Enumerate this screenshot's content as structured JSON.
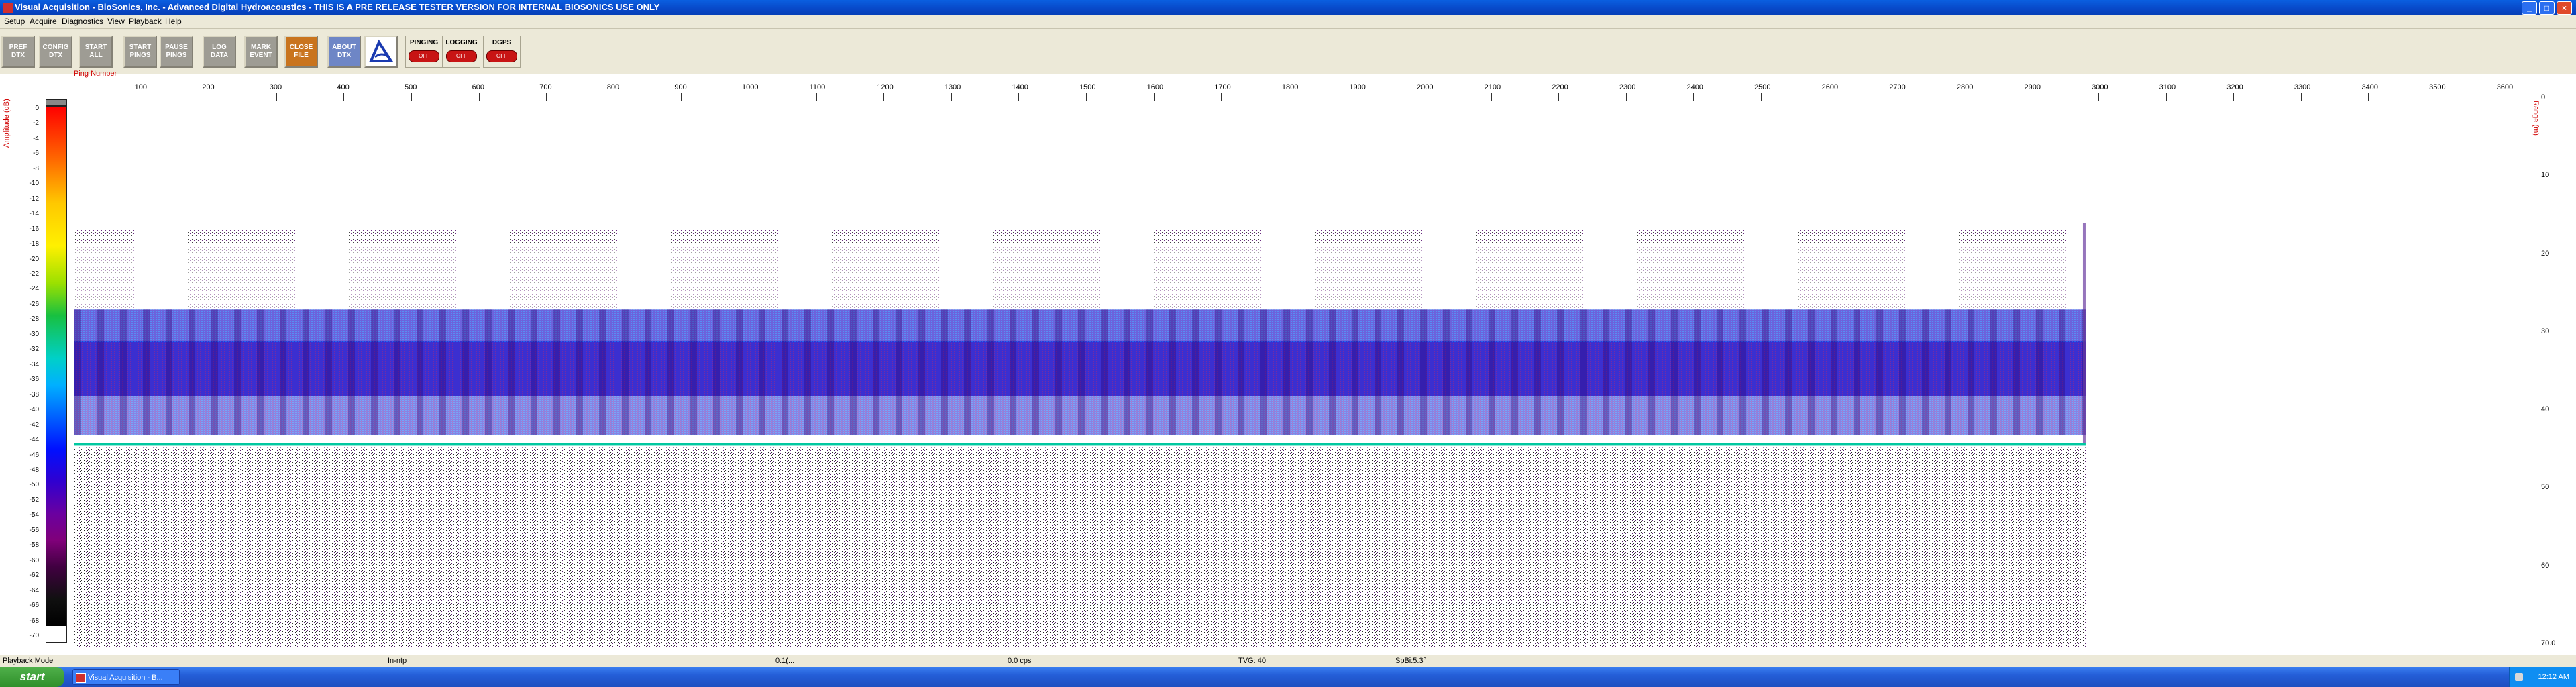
{
  "window": {
    "title": "Visual Acquisition  -  BioSonics, Inc.  -  Advanced Digital Hydroacoustics  -  THIS IS A PRE RELEASE TESTER VERSION FOR INTERNAL BIOSONICS USE ONLY",
    "minimize": "_",
    "maximize": "□",
    "close": "×"
  },
  "menu": [
    "Setup",
    "Acquire",
    "Diagnostics",
    "View",
    "Playback",
    "Help"
  ],
  "toolbar": {
    "buttons": [
      {
        "label": "PREF\nDTX",
        "style": "gray"
      },
      {
        "label": "CONFIG\nDTX",
        "style": "gray"
      },
      {
        "label": "START\nALL",
        "style": "gray"
      },
      {
        "label": "START\nPINGS",
        "style": "gray"
      },
      {
        "label": "PAUSE\nPINGS",
        "style": "gray"
      },
      {
        "label": "LOG\nDATA",
        "style": "gray"
      },
      {
        "label": "MARK\nEVENT",
        "style": "gray"
      },
      {
        "label": "CLOSE\nFILE",
        "style": "orange"
      },
      {
        "label": "ABOUT\nDTX",
        "style": "blue"
      }
    ],
    "indicators": [
      {
        "label": "PINGING",
        "state": "OFF"
      },
      {
        "label": "LOGGING",
        "state": "OFF"
      },
      {
        "label": "DGPS",
        "state": "OFF"
      }
    ]
  },
  "colors": {
    "accent": "#0848c8",
    "echo_main": "#2a2ad8",
    "bottom_line": "#00c8a0",
    "indicator_off": "#c81414"
  },
  "echogram": {
    "colorbar_label": "Amplitude (dB)",
    "colorbar_ticks": [
      0,
      -2,
      -4,
      -6,
      -8,
      -10,
      -12,
      -14,
      -16,
      -18,
      -20,
      -22,
      -24,
      -26,
      -28,
      -30,
      -32,
      -34,
      -36,
      -38,
      -40,
      -42,
      -44,
      -46,
      -48,
      -50,
      -52,
      -54,
      -56,
      -58,
      -60,
      -62,
      -64,
      -66,
      -68,
      -70
    ],
    "x_axis_label": "Ping Number",
    "x_ticks": [
      100,
      200,
      300,
      400,
      500,
      600,
      700,
      800,
      900,
      1000,
      1100,
      1200,
      1300,
      1400,
      1500,
      1600,
      1700,
      1800,
      1900,
      2000,
      2100,
      2200,
      2300,
      2400,
      2500,
      2600,
      2700,
      2800,
      2900,
      3000,
      3100,
      3200,
      3300,
      3400,
      3500,
      3600
    ],
    "range_label": "Range (m)",
    "range_ticks": [
      "0",
      "10",
      "20",
      "30",
      "40",
      "50",
      "60",
      "70.0"
    ],
    "last_ping": 2980,
    "max_range": 70
  },
  "status": {
    "mode": "Playback Mode",
    "field2": "In-ntp",
    "field3": "0.1(...",
    "field4": "0.0 cps",
    "field5": "TVG: 40",
    "field6": "SpBi:5.3°"
  },
  "taskbar": {
    "start": "start",
    "task": "Visual Acquisition - B...",
    "clock": "12:12 AM"
  }
}
